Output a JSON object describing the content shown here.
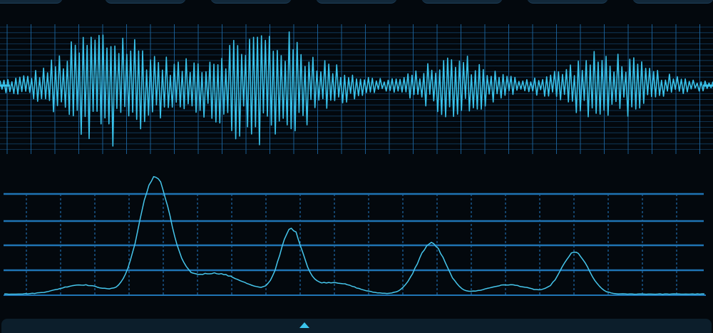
{
  "theme": {
    "background": "#03080d",
    "grid_color": "#1e6aa8",
    "grid_bold_color": "#1f74b4",
    "waveform_color": "#39c2ea",
    "envelope_color": "#46c6ec",
    "tab_color": "#12283a"
  },
  "toolbar": {
    "tabs": [
      {
        "name": "tab-1",
        "label": ""
      },
      {
        "name": "tab-2",
        "label": ""
      },
      {
        "name": "tab-3",
        "label": ""
      },
      {
        "name": "tab-4",
        "label": ""
      },
      {
        "name": "tab-5",
        "label": ""
      },
      {
        "name": "tab-6",
        "label": ""
      },
      {
        "name": "tab-7",
        "label": ""
      }
    ]
  },
  "waveform": {
    "bursts": [
      {
        "center": 0.15,
        "spread": 0.055,
        "amp": 0.95
      },
      {
        "center": 0.37,
        "spread": 0.065,
        "amp": 0.92
      },
      {
        "center": 0.64,
        "spread": 0.04,
        "amp": 0.45
      },
      {
        "center": 0.85,
        "spread": 0.05,
        "amp": 0.5
      }
    ],
    "baseline_amp": 0.08
  },
  "envelope": {
    "peaks": [
      {
        "center": 0.215,
        "spread": 0.022,
        "amp": 1.0
      },
      {
        "center": 0.41,
        "spread": 0.016,
        "amp": 0.55
      },
      {
        "center": 0.61,
        "spread": 0.02,
        "amp": 0.44
      },
      {
        "center": 0.815,
        "spread": 0.019,
        "amp": 0.36
      }
    ],
    "shoulders": [
      {
        "center": 0.3,
        "spread": 0.04,
        "amp": 0.18
      },
      {
        "center": 0.11,
        "spread": 0.03,
        "amp": 0.08
      },
      {
        "center": 0.47,
        "spread": 0.03,
        "amp": 0.1
      },
      {
        "center": 0.72,
        "spread": 0.03,
        "amp": 0.08
      }
    ]
  },
  "playback": {
    "position": 0.427
  }
}
